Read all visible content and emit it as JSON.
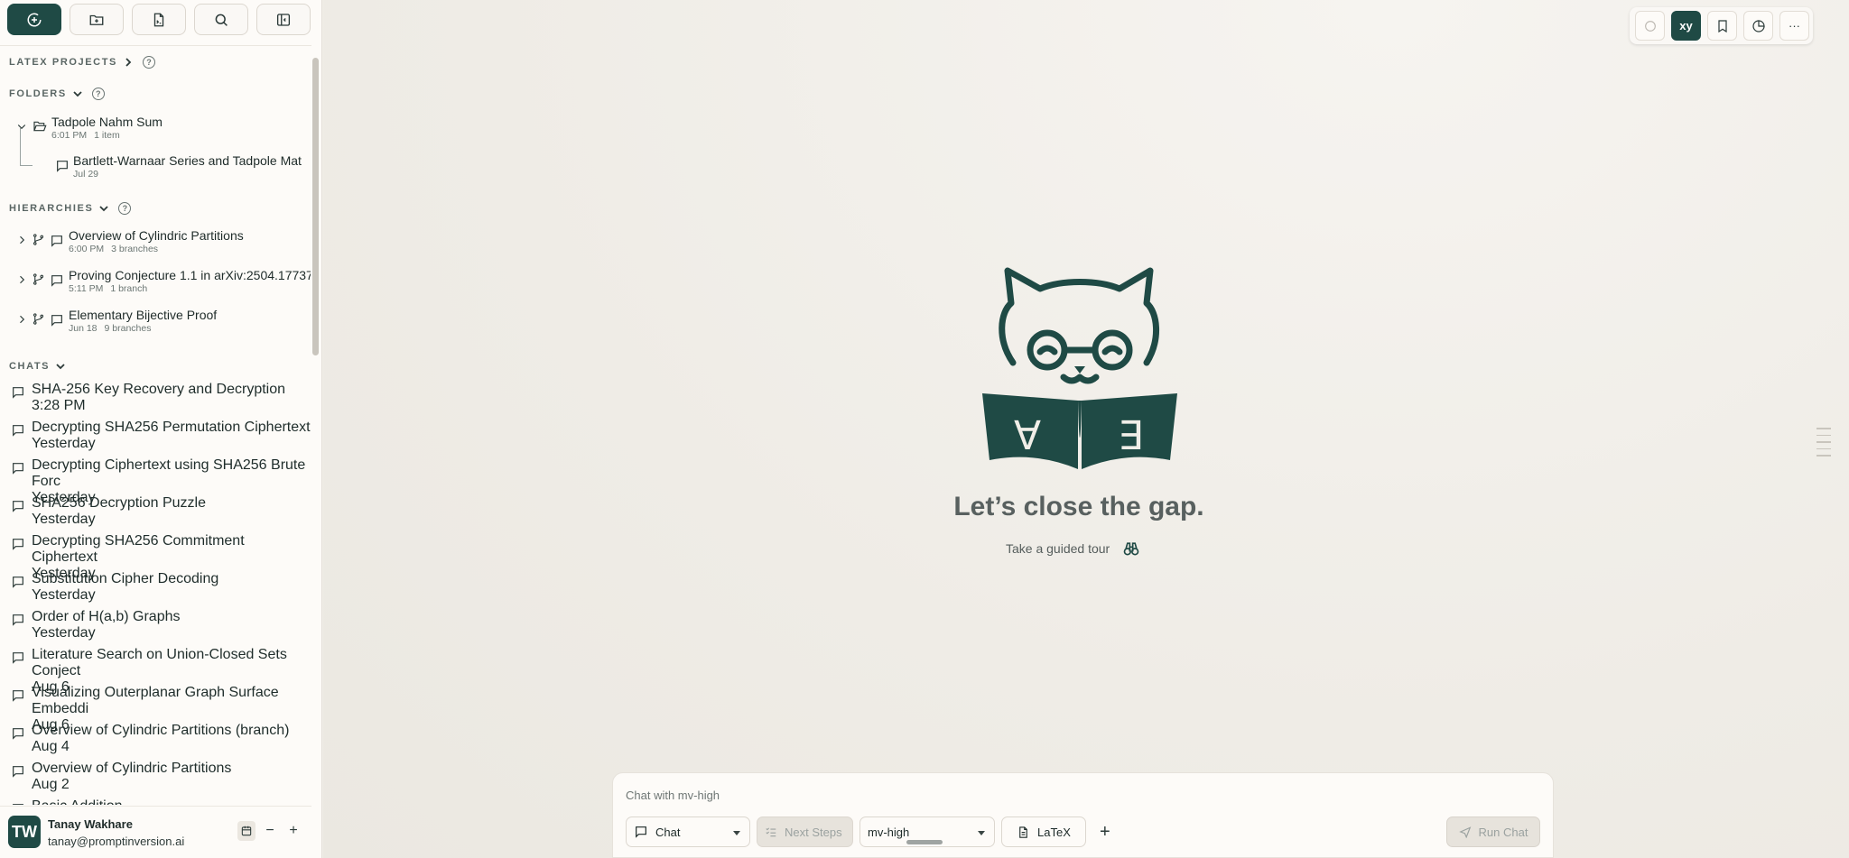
{
  "colors": {
    "accent": "#1f4a45",
    "background": "#f1eee8",
    "sidebar": "#fdfbf8"
  },
  "toolbar": {
    "buttons": [
      {
        "icon": "new-chat-icon"
      },
      {
        "icon": "new-folder-icon"
      },
      {
        "icon": "new-project-icon"
      },
      {
        "icon": "search-icon"
      },
      {
        "icon": "collapse-sidebar-icon"
      }
    ]
  },
  "sidebar": {
    "latex_projects_label": "LATEX PROJECTS",
    "folders_label": "FOLDERS",
    "hierarchies_label": "HIERARCHIES",
    "chats_label": "CHATS",
    "help_glyph": "?",
    "folder": {
      "title": "Tadpole Nahm Sum",
      "time": "6:01 PM",
      "count": "1 item"
    },
    "folder_child": {
      "title": "Bartlett-Warnaar Series and Tadpole Mat",
      "time": "Jul 29"
    },
    "hierarchies": [
      {
        "title": "Overview of Cylindric Partitions",
        "time": "6:00 PM",
        "count": "3 branches"
      },
      {
        "title": "Proving Conjecture 1.1 in arXiv:2504.17737",
        "time": "5:11 PM",
        "count": "1 branch"
      },
      {
        "title": "Elementary Bijective Proof",
        "time": "Jun 18",
        "count": "9 branches"
      }
    ],
    "chats": [
      {
        "title": "SHA-256 Key Recovery and Decryption",
        "time": "3:28 PM"
      },
      {
        "title": "Decrypting SHA256 Permutation Ciphertext",
        "time": "Yesterday"
      },
      {
        "title": "Decrypting Ciphertext using SHA256 Brute Forc",
        "time": "Yesterday"
      },
      {
        "title": "SHA256 Decryption Puzzle",
        "time": "Yesterday"
      },
      {
        "title": "Decrypting SHA256 Commitment Ciphertext",
        "time": "Yesterday"
      },
      {
        "title": "Substitution Cipher Decoding",
        "time": "Yesterday"
      },
      {
        "title": "Order of H(a,b) Graphs",
        "time": "Yesterday"
      },
      {
        "title": "Literature Search on Union-Closed Sets Conject",
        "time": "Aug 6"
      },
      {
        "title": "Visualizing Outerplanar Graph Surface Embeddi",
        "time": "Aug 6"
      },
      {
        "title": "Overview of Cylindric Partitions (branch)",
        "time": "Aug 4"
      },
      {
        "title": "Overview of Cylindric Partitions",
        "time": "Aug 2"
      },
      {
        "title": "Basic Addition",
        "time": ""
      }
    ]
  },
  "user": {
    "initials": "TW",
    "name": "Tanay Wakhare",
    "email": "tanay@promptinversion.ai",
    "minus": "−",
    "plus": "+"
  },
  "topright": {
    "xy_label": "xy",
    "more_label": "···"
  },
  "hero": {
    "headline": "Let’s close the gap.",
    "tour_label": "Take a guided tour",
    "book_left": "∀",
    "book_right": "∃"
  },
  "composer": {
    "placeholder": "Chat with mv-high",
    "mode": "Chat",
    "next_steps": "Next Steps",
    "model": "mv-high",
    "latex": "LaTeX",
    "add": "+",
    "run": "Run Chat"
  }
}
